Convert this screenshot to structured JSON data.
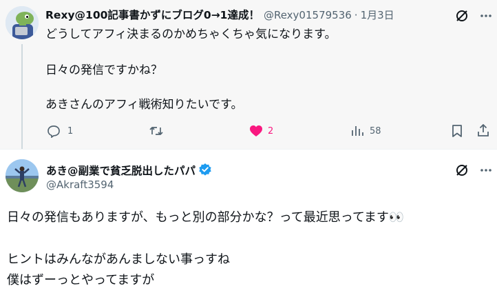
{
  "post1": {
    "author_name": "Rexy@100記事書かずにブログ0→1達成！",
    "handle": "@Rexy01579536",
    "separator": "·",
    "date": "1月3日",
    "lines": [
      "どうしてアフィ決まるのかめちゃくちゃ気になります。",
      "日々の発信ですかね？",
      "あきさんのアフィ戦術知りたいです。"
    ],
    "reply_count": "1",
    "like_count": "2",
    "views_count": "58"
  },
  "post2": {
    "author_name": "あき@副業で貧乏脱出したパパ",
    "handle": "@Akraft3594",
    "lines": [
      "日々の発信もありますが、もっと別の部分かな？って最近思ってます👀",
      "ヒントはみんながあんましない事っすね",
      "僕はずーっとやってますが"
    ]
  },
  "colors": {
    "like_pink": "#f91880",
    "muted": "#536471",
    "verified_blue": "#1d9bf0"
  }
}
